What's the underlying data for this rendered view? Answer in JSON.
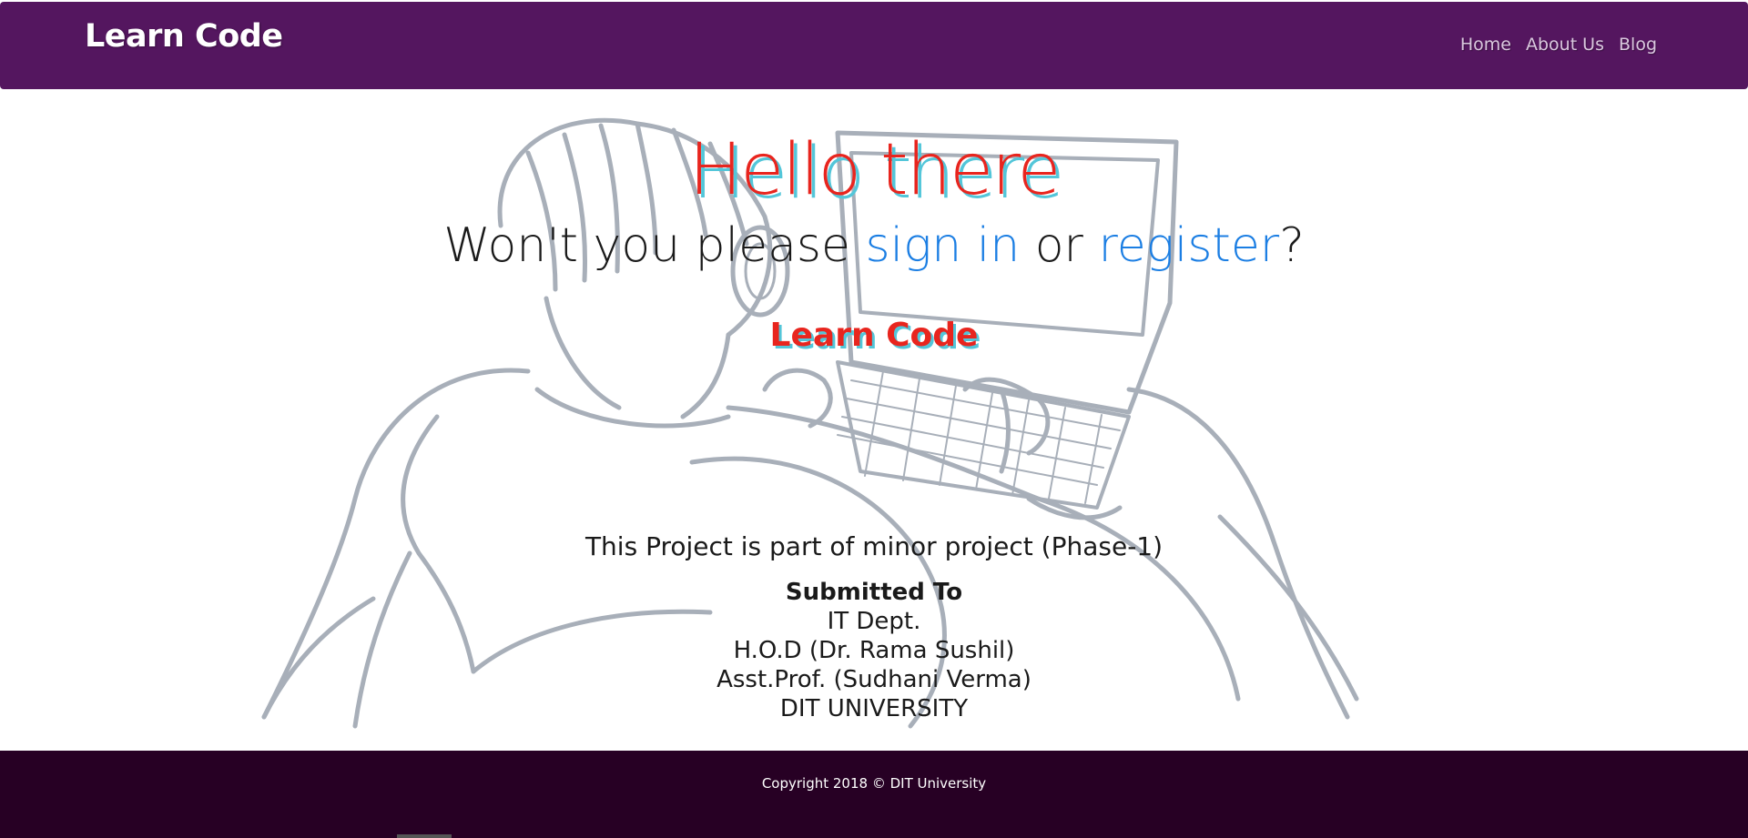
{
  "navbar": {
    "brand": "Learn Code",
    "links": [
      "Home",
      "About Us",
      "Blog"
    ]
  },
  "hero": {
    "title": "Hello there",
    "prompt_prefix": "Won't you please ",
    "sign_in_label": "sign in",
    "prompt_middle": " or ",
    "register_label": "register",
    "prompt_suffix": "?",
    "logo_text": "Learn Code"
  },
  "info": {
    "project_note": "This Project is part of minor project (Phase-1)",
    "submitted_heading": "Submitted To",
    "submitted_lines": [
      "IT Dept.",
      "H.O.D (Dr. Rama Sushil)",
      "Asst.Prof. (Sudhani Verma)",
      "DIT UNIVERSITY"
    ]
  },
  "footer": {
    "copyright": "Copyright 2018 © DIT University"
  },
  "colors": {
    "navbar": "#54165f",
    "footer": "#270024",
    "accent_red": "#e8251e",
    "shadow_cyan": "#53c6d9",
    "link_blue": "#1b7ee3",
    "sketch_gray": "#a8afb9"
  },
  "icons": {
    "hero_illustration": "person-with-laptop-sketch"
  }
}
